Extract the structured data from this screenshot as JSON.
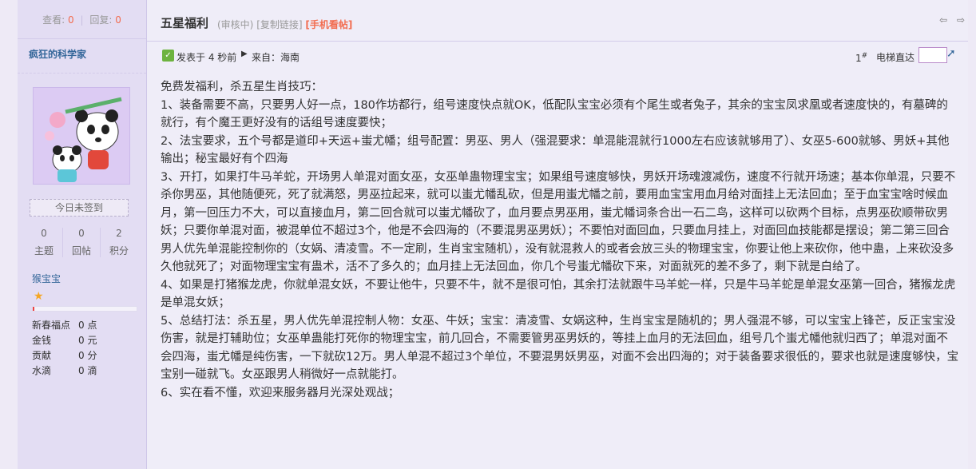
{
  "sidebar": {
    "views_label": "查看:",
    "views_value": "0",
    "replies_label": "回复:",
    "replies_value": "0",
    "username": "疯狂的科学家",
    "checkin_label": "今日未签到",
    "counts": [
      {
        "value": "0",
        "label": "主题"
      },
      {
        "value": "0",
        "label": "回帖"
      },
      {
        "value": "2",
        "label": "积分"
      }
    ],
    "group": "猴宝宝",
    "credits": [
      {
        "key": "新春福点",
        "value": "0 点"
      },
      {
        "key": "金钱",
        "value": "0 元"
      },
      {
        "key": "贡献",
        "value": "0 分"
      },
      {
        "key": "水滴",
        "value": "0 滴"
      }
    ]
  },
  "header": {
    "title": "五星福利",
    "status": "(审核中)",
    "copy_link": "[复制链接]",
    "mobile": "[手机看帖]"
  },
  "post": {
    "posted": "发表于 4 秒前",
    "from": "来自：海南",
    "floor": "1",
    "floor_sup": "#",
    "jump_label": "电梯直达",
    "lines": [
      "免费发福利，杀五星生肖技巧：",
      "1、装备需要不高，只要男人好一点，180作坊都行，组号速度快点就OK，低配队宝宝必须有个尾生或者兔子，其余的宝宝凤求凰或者速度快的，有墓碑的就行，有个魔王更好没有的话组号速度要快；",
      "2、法宝要求，五个号都是道印+天运+蚩尤幡；组号配置：男巫、男人（强混要求：单混能混就行1000左右应该就够用了）、女巫5-600就够、男妖+其他输出；秘宝最好有个四海",
      "3、开打，如果打牛马羊蛇，开场男人单混对面女巫，女巫单蛊物理宝宝；如果组号速度够快，男妖开场魂渡减伤，速度不行就开场速；基本你单混，只要不杀你男巫，其他随便死，死了就满怒，男巫拉起来，就可以蚩尤幡乱砍，但是用蚩尤幡之前，要用血宝宝用血月给对面挂上无法回血；至于血宝宝啥时候血月，第一回压力不大，可以直接血月，第二回合就可以蚩尤幡砍了，血月要点男巫用，蚩尤幡词条合出一石二鸟，这样可以砍两个目标，点男巫砍顺带砍男妖；只要你单混对面，被混单位不超过3个，他是不会四海的（不要混男巫男妖）；不要怕对面回血，只要血月挂上，对面回血技能都是摆设；第二第三回合男人优先单混能控制你的（女娲、清凌雪。不一定刷，生肖宝宝随机），没有就混救人的或者会放三头的物理宝宝，你要让他上来砍你，他中蛊，上来砍没多久他就死了；对面物理宝宝有蛊术，活不了多久的；血月挂上无法回血，你几个号蚩尤幡砍下来，对面就死的差不多了，剩下就是白给了。",
      "4、如果是打猪猴龙虎，你就单混女妖，不要让他牛，只要不牛，就不是很可怕，其余打法就跟牛马羊蛇一样，只是牛马羊蛇是单混女巫第一回合，猪猴龙虎是单混女妖；",
      "5、总结打法：杀五星，男人优先单混控制人物：女巫、牛妖；宝宝：清凌雪、女娲这种，生肖宝宝是随机的；男人强混不够，可以宝宝上锋芒，反正宝宝没伤害，就是打辅助位；女巫单蛊能打死你的物理宝宝，前几回合，不需要管男巫男妖的，等挂上血月的无法回血，组号几个蚩尤幡他就归西了；单混对面不会四海，蚩尤幡是纯伤害，一下就砍12万。男人单混不超过3个单位，不要混男妖男巫，对面不会出四海的；对于装备要求很低的，要求也就是速度够快，宝宝别一碰就飞。女巫跟男人稍微好一点就能打。",
      "6、实在看不懂，欢迎来服务器月光深处观战；"
    ]
  },
  "colors": {
    "accent": "#336699",
    "highlight": "#f26c4f",
    "sidebar_bg": "#e3ddf3",
    "main_bg": "#efedf8"
  }
}
